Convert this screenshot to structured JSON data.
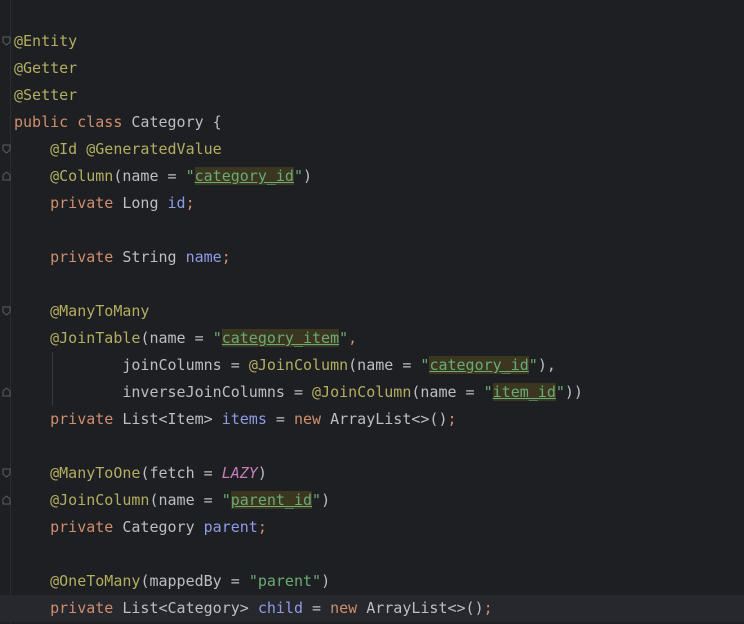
{
  "lines": [
    {
      "parts": [
        {
          "t": "@Entity",
          "c": "ann"
        }
      ]
    },
    {
      "parts": [
        {
          "t": "@Getter",
          "c": "ann"
        }
      ]
    },
    {
      "parts": [
        {
          "t": "@Setter",
          "c": "ann"
        }
      ]
    },
    {
      "parts": [
        {
          "t": "public",
          "c": "kw"
        },
        {
          "t": " ",
          "c": "plain"
        },
        {
          "t": "class",
          "c": "kw"
        },
        {
          "t": " Category {",
          "c": "plain"
        }
      ]
    },
    {
      "parts": [
        {
          "t": "    ",
          "c": "plain"
        },
        {
          "t": "@Id",
          "c": "ann"
        },
        {
          "t": " ",
          "c": "plain"
        },
        {
          "t": "@GeneratedValue",
          "c": "ann"
        }
      ]
    },
    {
      "parts": [
        {
          "t": "    ",
          "c": "plain"
        },
        {
          "t": "@Column",
          "c": "ann"
        },
        {
          "t": "(name = ",
          "c": "plain"
        },
        {
          "t": "\"",
          "c": "str"
        },
        {
          "t": "category_id",
          "c": "inject"
        },
        {
          "t": "\"",
          "c": "str"
        },
        {
          "t": ")",
          "c": "plain"
        }
      ]
    },
    {
      "parts": [
        {
          "t": "    ",
          "c": "plain"
        },
        {
          "t": "private",
          "c": "kw"
        },
        {
          "t": " Long ",
          "c": "plain"
        },
        {
          "t": "id",
          "c": "memb"
        },
        {
          "t": ";",
          "c": "kw"
        }
      ]
    },
    {
      "parts": [
        {
          "t": "",
          "c": "plain"
        }
      ]
    },
    {
      "parts": [
        {
          "t": "    ",
          "c": "plain"
        },
        {
          "t": "private",
          "c": "kw"
        },
        {
          "t": " String ",
          "c": "plain"
        },
        {
          "t": "name",
          "c": "memb"
        },
        {
          "t": ";",
          "c": "kw"
        }
      ]
    },
    {
      "parts": [
        {
          "t": "",
          "c": "plain"
        }
      ]
    },
    {
      "parts": [
        {
          "t": "    ",
          "c": "plain"
        },
        {
          "t": "@ManyToMany",
          "c": "ann"
        }
      ]
    },
    {
      "parts": [
        {
          "t": "    ",
          "c": "plain"
        },
        {
          "t": "@JoinTable",
          "c": "ann"
        },
        {
          "t": "(name = ",
          "c": "plain"
        },
        {
          "t": "\"",
          "c": "str"
        },
        {
          "t": "category_item",
          "c": "inject"
        },
        {
          "t": "\"",
          "c": "str"
        },
        {
          "t": ",",
          "c": "kw"
        }
      ]
    },
    {
      "parts": [
        {
          "t": "            joinColumns = ",
          "c": "plain"
        },
        {
          "t": "@JoinColumn",
          "c": "ann"
        },
        {
          "t": "(name = ",
          "c": "plain"
        },
        {
          "t": "\"",
          "c": "str"
        },
        {
          "t": "category_id",
          "c": "inject"
        },
        {
          "t": "\"",
          "c": "str"
        },
        {
          "t": "),",
          "c": "plain"
        }
      ]
    },
    {
      "parts": [
        {
          "t": "            inverseJoinColumns = ",
          "c": "plain"
        },
        {
          "t": "@JoinColumn",
          "c": "ann"
        },
        {
          "t": "(name = ",
          "c": "plain"
        },
        {
          "t": "\"",
          "c": "str"
        },
        {
          "t": "item_id",
          "c": "inject"
        },
        {
          "t": "\"",
          "c": "str"
        },
        {
          "t": "))",
          "c": "plain"
        }
      ]
    },
    {
      "parts": [
        {
          "t": "    ",
          "c": "plain"
        },
        {
          "t": "private",
          "c": "kw"
        },
        {
          "t": " List<Item> ",
          "c": "plain"
        },
        {
          "t": "items",
          "c": "memb"
        },
        {
          "t": " = ",
          "c": "plain"
        },
        {
          "t": "new",
          "c": "kw"
        },
        {
          "t": " ArrayList<>()",
          "c": "plain"
        },
        {
          "t": ";",
          "c": "kw"
        }
      ]
    },
    {
      "parts": [
        {
          "t": "",
          "c": "plain"
        }
      ]
    },
    {
      "parts": [
        {
          "t": "    ",
          "c": "plain"
        },
        {
          "t": "@ManyToOne",
          "c": "ann"
        },
        {
          "t": "(fetch = ",
          "c": "plain"
        },
        {
          "t": "LAZY",
          "c": "const"
        },
        {
          "t": ")",
          "c": "plain"
        }
      ]
    },
    {
      "parts": [
        {
          "t": "    ",
          "c": "plain"
        },
        {
          "t": "@JoinColumn",
          "c": "ann"
        },
        {
          "t": "(name = ",
          "c": "plain"
        },
        {
          "t": "\"",
          "c": "str"
        },
        {
          "t": "parent_id",
          "c": "inject"
        },
        {
          "t": "\"",
          "c": "str"
        },
        {
          "t": ")",
          "c": "plain"
        }
      ]
    },
    {
      "parts": [
        {
          "t": "    ",
          "c": "plain"
        },
        {
          "t": "private",
          "c": "kw"
        },
        {
          "t": " Category ",
          "c": "plain"
        },
        {
          "t": "parent",
          "c": "memb"
        },
        {
          "t": ";",
          "c": "kw"
        }
      ]
    },
    {
      "parts": [
        {
          "t": "",
          "c": "plain"
        }
      ]
    },
    {
      "parts": [
        {
          "t": "    ",
          "c": "plain"
        },
        {
          "t": "@OneToMany",
          "c": "ann"
        },
        {
          "t": "(mappedBy = ",
          "c": "plain"
        },
        {
          "t": "\"parent\"",
          "c": "str"
        },
        {
          "t": ")",
          "c": "plain"
        }
      ]
    },
    {
      "parts": [
        {
          "t": "    ",
          "c": "plain"
        },
        {
          "t": "private",
          "c": "kw"
        },
        {
          "t": " List<Category> ",
          "c": "plain"
        },
        {
          "t": "child",
          "c": "memb"
        },
        {
          "t": " = ",
          "c": "plain"
        },
        {
          "t": "new",
          "c": "kw"
        },
        {
          "t": " ArrayList<>()",
          "c": "plain"
        },
        {
          "t": ";",
          "c": "kw"
        }
      ]
    }
  ],
  "current_line": 21,
  "colors": {
    "background": "#1e1f22",
    "annotation": "#b3ae60",
    "keyword": "#cf8e6d",
    "string": "#6aab73",
    "member": "#8f9be7"
  }
}
